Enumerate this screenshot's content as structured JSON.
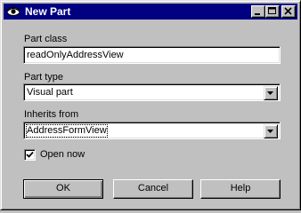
{
  "window": {
    "title": "New Part",
    "icon": "eye-icon",
    "controls": [
      "minimize-icon",
      "maximize-icon",
      "close-icon"
    ]
  },
  "form": {
    "part_class_label": "Part class",
    "part_class_value": "readOnlyAddressView",
    "part_type_label": "Part type",
    "part_type_value": "Visual part",
    "inherits_label": "Inherits from",
    "inherits_value": "AddressFormView",
    "open_now_label": "Open now",
    "open_now_checked": true
  },
  "buttons": {
    "ok": "OK",
    "cancel": "Cancel",
    "help": "Help"
  }
}
